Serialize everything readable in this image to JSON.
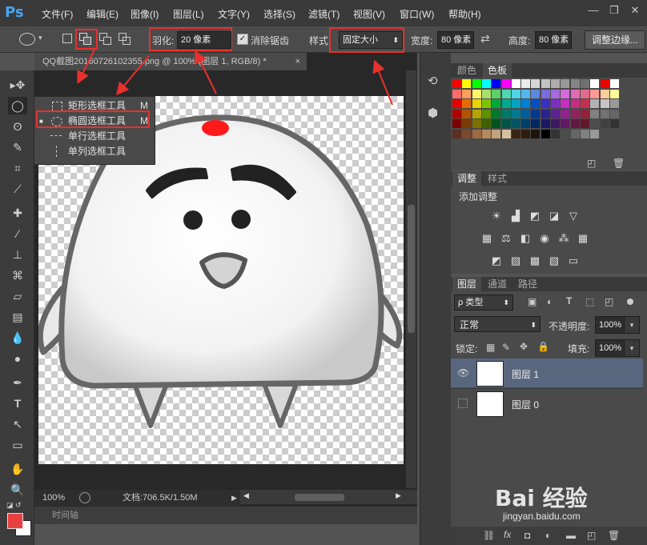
{
  "app": {
    "logo": "Ps"
  },
  "menu": [
    "文件(F)",
    "编辑(E)",
    "图像(I)",
    "图层(L)",
    "文字(Y)",
    "选择(S)",
    "滤镜(T)",
    "视图(V)",
    "窗口(W)",
    "帮助(H)"
  ],
  "window_controls": {
    "minimize": "—",
    "restore": "❐",
    "close": "✕"
  },
  "options": {
    "feather_label": "羽化:",
    "feather_value": "20 像素",
    "antialias_label": "消除锯齿",
    "style_label": "样式",
    "style_value": "固定大小",
    "width_label": "宽度:",
    "width_value": "80 像素",
    "height_label": "高度:",
    "height_value": "80 像素",
    "refine_button": "调整边缘..."
  },
  "document": {
    "tab_title": "QQ截图20160726102355.png @ 100% (图层 1, RGB/8) *",
    "tab_close": "×",
    "zoom": "100%",
    "doc_size": "文档:706.5K/1.50M"
  },
  "timeline_label": "时间轴",
  "tool_dropdown": [
    {
      "label": "矩形选框工具",
      "key": "M",
      "selected": false
    },
    {
      "label": "椭圆选框工具",
      "key": "M",
      "selected": true
    },
    {
      "label": "单行选框工具",
      "key": "",
      "selected": false
    },
    {
      "label": "单列选框工具",
      "key": "",
      "selected": false
    }
  ],
  "panels": {
    "color_tabs": [
      "颜色",
      "色板"
    ],
    "adjust_tabs": [
      "调整",
      "样式"
    ],
    "adjust_title": "添加调整",
    "layers_tabs": [
      "图层",
      "通道",
      "路径"
    ],
    "kind_label": "ρ 类型",
    "blend_mode": "正常",
    "opacity_label": "不透明度:",
    "opacity_value": "100%",
    "lock_label": "锁定:",
    "fill_label": "填充:",
    "fill_value": "100%",
    "layers": [
      {
        "name": "图层 1",
        "visible": true,
        "selected": true
      },
      {
        "name": "图层 0",
        "visible": false,
        "selected": false
      }
    ]
  },
  "watermark": {
    "brand": "Bai 经验",
    "url": "jingyan.baidu.com"
  },
  "colors": {
    "accent_red": "#e8302c",
    "foreground": "#e84040",
    "background": "#ffffff"
  }
}
